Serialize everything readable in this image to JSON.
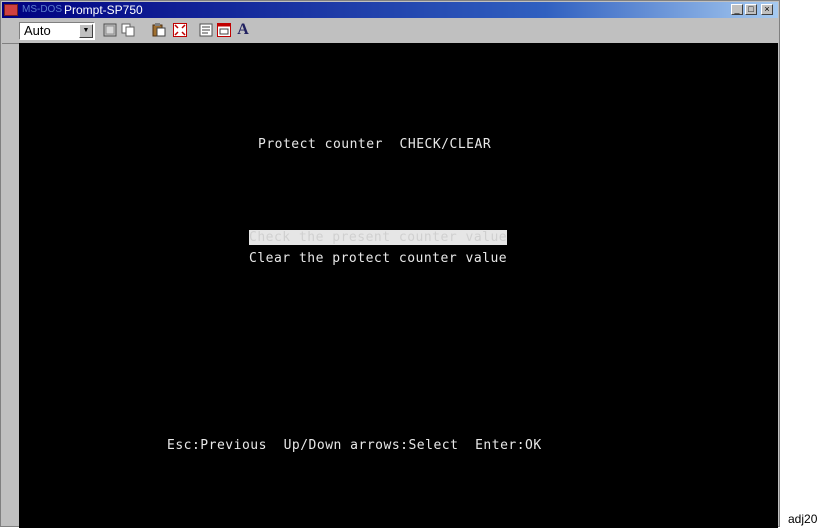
{
  "window": {
    "title_prefix": "MS-DOS",
    "title": "Prompt-SP750",
    "controls": {
      "minimize": "_",
      "maximize": "□",
      "close": "×"
    }
  },
  "toolbar": {
    "font_size_value": "Auto",
    "buttons": [
      "mark-icon",
      "copy-icon",
      "paste-icon",
      "fullscreen-icon",
      "properties-icon",
      "background-icon",
      "font-icon"
    ]
  },
  "console": {
    "heading": "Protect counter  CHECK/CLEAR",
    "menu": [
      {
        "label": "Check the present counter value",
        "selected": true
      },
      {
        "label": "Clear the protect counter value",
        "selected": false
      }
    ],
    "footer": "Esc:Previous  Up/Down arrows:Select  Enter:OK"
  },
  "caption": "adj20",
  "colors": {
    "console_bg": "#000000",
    "console_text": "#e8e8e8",
    "highlight": "#e6e6e6",
    "title_bar": "#000080"
  }
}
